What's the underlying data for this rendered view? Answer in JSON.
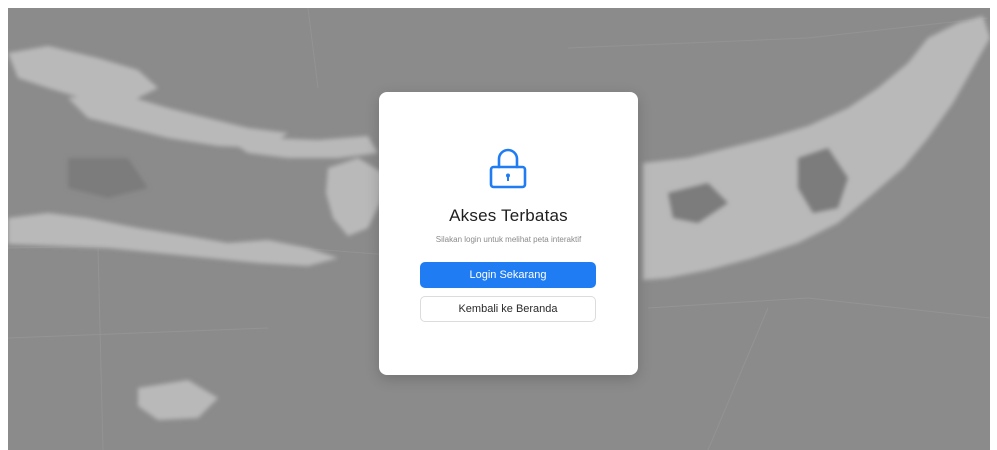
{
  "modal": {
    "title": "Akses Terbatas",
    "subtitle": "Silakan login untuk melihat peta interaktif",
    "login_button": "Login Sekarang",
    "back_button": "Kembali ke Beranda",
    "icon": "lock-icon"
  },
  "colors": {
    "accent": "#1f7cf2",
    "overlay": "#8d8d8d",
    "card": "#ffffff"
  }
}
